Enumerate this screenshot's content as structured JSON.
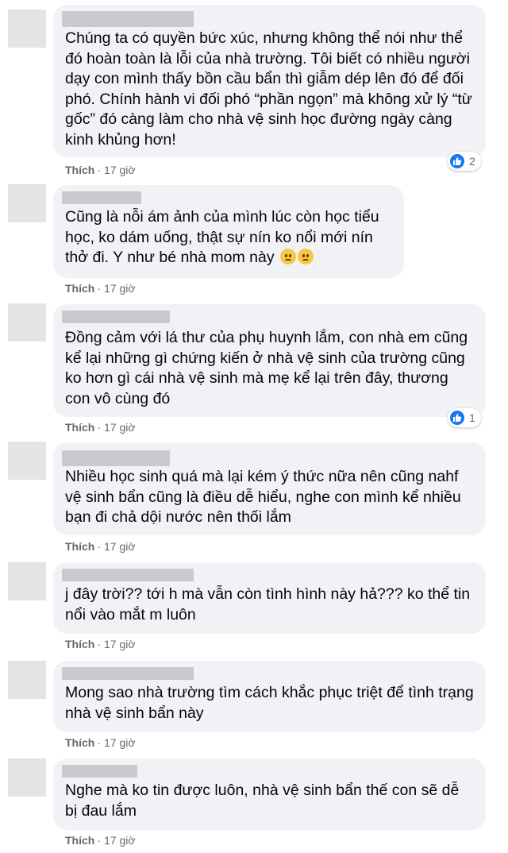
{
  "comments": [
    {
      "text": "Chúng ta có quyền bức xúc, nhưng không thể nói như thể đó hoàn toàn là lỗi của nhà trường. Tôi biết có nhiều người dạy con mình thấy bồn cầu bẩn thì giẫm dép lên đó để đối phó. Chính hành vi đối phó “phần ngọn” mà không xử lý “từ gốc” đó càng làm cho nhà vệ sinh học đường ngày càng kinh khủng hơn!",
      "like_label": "Thích",
      "time": "17 giờ",
      "reaction_count": "2"
    },
    {
      "text": "Cũng là nỗi ám ảnh của mình lúc còn học tiểu học, ko dám uống, thật sự nín ko nổi mới nín thở đi. Y như bé nhà mom này",
      "like_label": "Thích",
      "time": "17 giờ"
    },
    {
      "text": "Đồng cảm với lá thư của phụ huynh lắm, con nhà em cũng kể lại những gì chứng kiến ở nhà vệ sinh của trường cũng ko hơn gì cái nhà vệ sinh mà mẹ kể lại trên đây, thương con vô cùng đó",
      "like_label": "Thích",
      "time": "17 giờ",
      "reaction_count": "1"
    },
    {
      "text": "Nhiều học sinh quá mà lại kém ý thức nữa nên cũng nahf vệ sinh bẩn cũng là điều dễ hiểu, nghe con mình kể nhiều bạn đi chả dội nước nên thối lắm",
      "like_label": "Thích",
      "time": "17 giờ"
    },
    {
      "text": "j đây trời?? tới h mà vẫn còn tình hình này hả??? ko thể tin nổi vào mắt m luôn",
      "like_label": "Thích",
      "time": "17 giờ"
    },
    {
      "text": "Mong sao nhà trường tìm cách khắc phục triệt để tình trạng nhà vệ sinh bẩn này",
      "like_label": "Thích",
      "time": "17 giờ"
    },
    {
      "text": "Nghe mà ko tin được luôn, nhà vệ sinh bẩn thế con sẽ dễ bị đau lắm",
      "like_label": "Thích",
      "time": "17 giờ"
    }
  ],
  "colors": {
    "bubble": "#f0f2f5",
    "meta": "#65676b",
    "like_blue": "#1877f2"
  }
}
